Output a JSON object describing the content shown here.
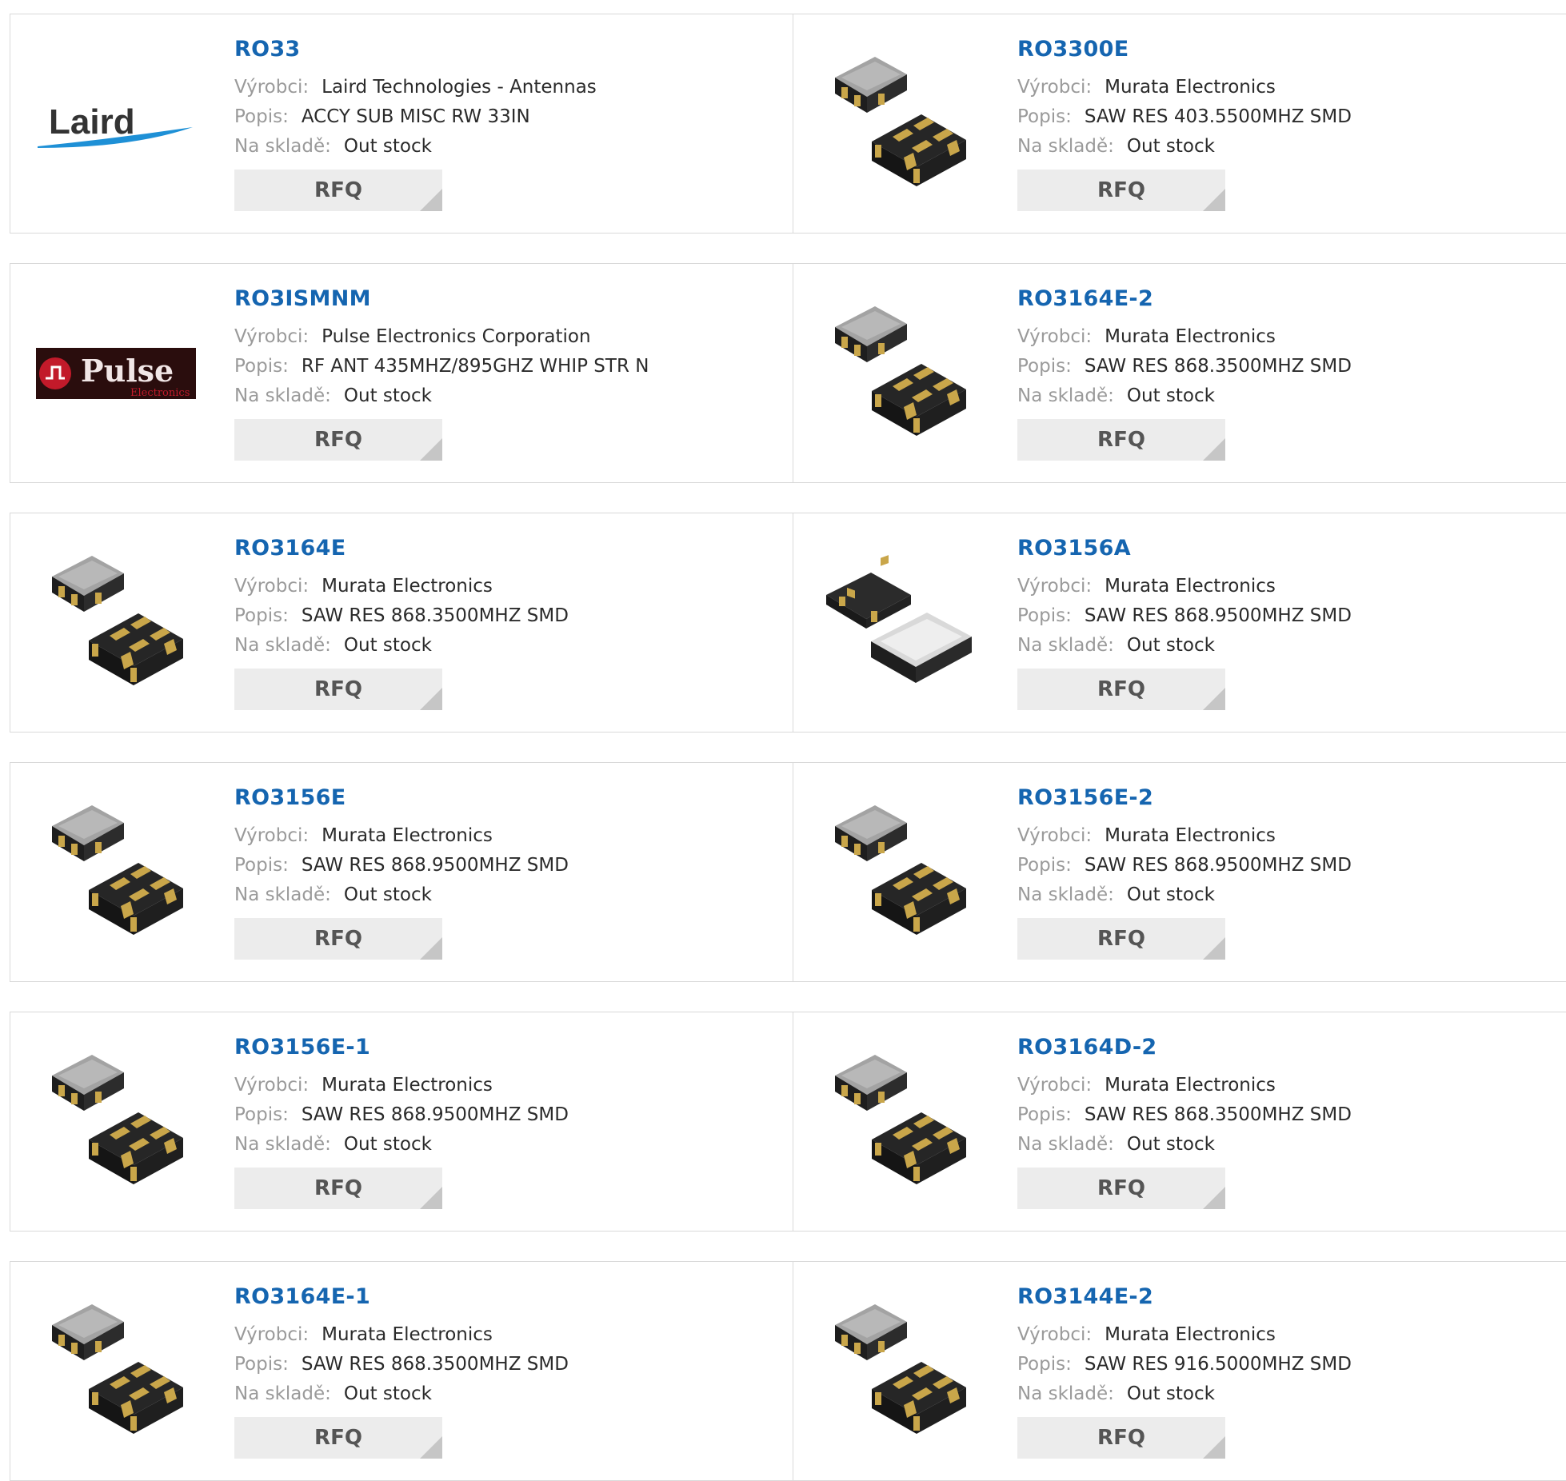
{
  "labels": {
    "manufacturer": "Výrobci:",
    "description": "Popis:",
    "stock": "Na skladě:",
    "rfq": "RFQ"
  },
  "products": [
    {
      "part": "RO33",
      "manufacturer": "Laird Technologies - Antennas",
      "description": "ACCY SUB MISC RW 33IN",
      "stock": "Out stock",
      "image": "laird-logo"
    },
    {
      "part": "RO3300E",
      "manufacturer": "Murata Electronics",
      "description": "SAW RES 403.5500MHZ SMD",
      "stock": "Out stock",
      "image": "saw-resonator"
    },
    {
      "part": "RO3ISMNM",
      "manufacturer": "Pulse Electronics Corporation",
      "description": "RF ANT 435MHZ/895GHZ WHIP STR N",
      "stock": "Out stock",
      "image": "pulse-logo"
    },
    {
      "part": "RO3164E-2",
      "manufacturer": "Murata Electronics",
      "description": "SAW RES 868.3500MHZ SMD",
      "stock": "Out stock",
      "image": "saw-resonator"
    },
    {
      "part": "RO3164E",
      "manufacturer": "Murata Electronics",
      "description": "SAW RES 868.3500MHZ SMD",
      "stock": "Out stock",
      "image": "saw-resonator"
    },
    {
      "part": "RO3156A",
      "manufacturer": "Murata Electronics",
      "description": "SAW RES 868.9500MHZ SMD",
      "stock": "Out stock",
      "image": "saw-resonator-metal"
    },
    {
      "part": "RO3156E",
      "manufacturer": "Murata Electronics",
      "description": "SAW RES 868.9500MHZ SMD",
      "stock": "Out stock",
      "image": "saw-resonator"
    },
    {
      "part": "RO3156E-2",
      "manufacturer": "Murata Electronics",
      "description": "SAW RES 868.9500MHZ SMD",
      "stock": "Out stock",
      "image": "saw-resonator"
    },
    {
      "part": "RO3156E-1",
      "manufacturer": "Murata Electronics",
      "description": "SAW RES 868.9500MHZ SMD",
      "stock": "Out stock",
      "image": "saw-resonator"
    },
    {
      "part": "RO3164D-2",
      "manufacturer": "Murata Electronics",
      "description": "SAW RES 868.3500MHZ SMD",
      "stock": "Out stock",
      "image": "saw-resonator"
    },
    {
      "part": "RO3164E-1",
      "manufacturer": "Murata Electronics",
      "description": "SAW RES 868.3500MHZ SMD",
      "stock": "Out stock",
      "image": "saw-resonator"
    },
    {
      "part": "RO3144E-2",
      "manufacturer": "Murata Electronics",
      "description": "SAW RES 916.5000MHZ SMD",
      "stock": "Out stock",
      "image": "saw-resonator"
    }
  ],
  "logos": {
    "laird": "Laird",
    "pulse": "Pulse",
    "pulse_sub": "Electronics"
  },
  "colors": {
    "link": "#1565b0",
    "label": "#9a9a9a",
    "rfq_bg": "#ececec"
  }
}
